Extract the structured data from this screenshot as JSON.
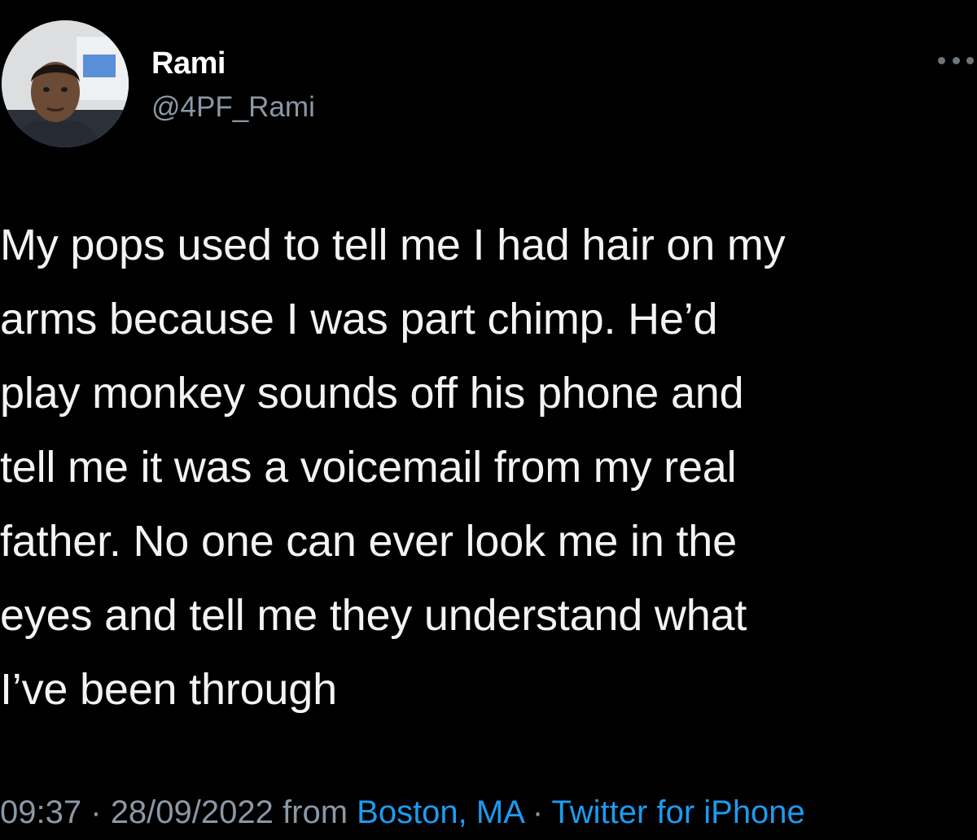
{
  "author": {
    "display_name": "Rami",
    "handle": "@4PF_Rami",
    "avatar_icon": "profile-photo"
  },
  "more_menu_icon": "more-options-icon",
  "tweet": {
    "lines": [
      "My pops used to tell me I had hair on my",
      "arms because I was part chimp. He’d",
      "play monkey sounds off his phone and",
      "tell me it was a voicemail from my real",
      "father. No one can ever look me in the",
      "eyes and tell me they understand what",
      "I’ve been through"
    ]
  },
  "meta": {
    "time": "09:37",
    "separator": "·",
    "date": "28/09/2022",
    "from_label": "from",
    "location": "Boston, MA",
    "source": "Twitter for iPhone"
  },
  "colors": {
    "background": "#000000",
    "secondary_text": "#8b98a5",
    "link": "#1d9bf0"
  }
}
